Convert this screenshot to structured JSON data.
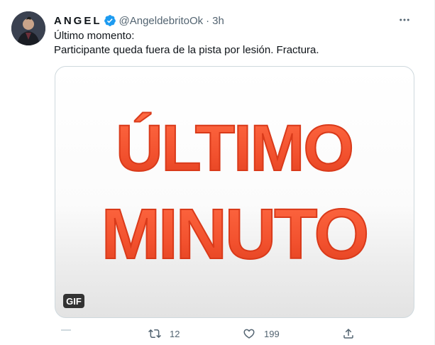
{
  "tweet": {
    "display_name": "ANGEL",
    "handle": "@AngeldebritoOk",
    "time": "3h",
    "text_line1": "Último momento:",
    "text_line2": "Participante queda fuera de la pista por lesión. Fractura.",
    "media": {
      "line1": "ÚLTIMO",
      "line2": "MINUTO",
      "badge": "GIF",
      "text_color": "#f2512e"
    },
    "actions": {
      "retweets": "12",
      "likes": "199"
    }
  },
  "colors": {
    "verified": "#1d9bf0",
    "secondary_text": "#536471",
    "border": "#cfd9de"
  },
  "icons": [
    "verified-badge-icon",
    "more-icon",
    "retweet-icon",
    "like-icon",
    "share-icon"
  ]
}
